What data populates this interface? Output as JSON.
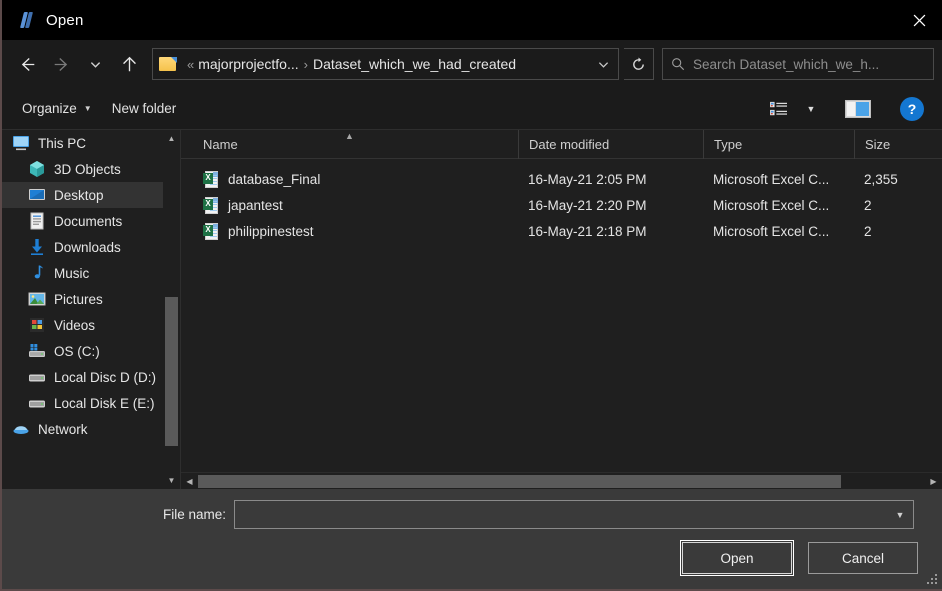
{
  "window": {
    "title": "Open",
    "icon": "python-file-icon",
    "close_label": "Close"
  },
  "nav": {
    "back": "Back",
    "forward": "Forward",
    "recent": "Recent locations",
    "up": "Up one level",
    "refresh": "Refresh",
    "breadcrumb": {
      "overflow": "«",
      "separator": "›",
      "parent": "majorprojectfo...",
      "current": "Dataset_which_we_had_created"
    },
    "search": {
      "placeholder": "Search Dataset_which_we_h...",
      "value": ""
    }
  },
  "commandbar": {
    "organize": "Organize",
    "new_folder": "New folder",
    "change_view": "Change your view",
    "preview_pane": "Show the preview pane",
    "help": "?"
  },
  "sidebar": {
    "items": [
      {
        "label": "This PC",
        "icon": "monitor-icon",
        "root": true,
        "selected": false
      },
      {
        "label": "3D Objects",
        "icon": "cube-icon",
        "root": false,
        "selected": false
      },
      {
        "label": "Desktop",
        "icon": "desktop-icon",
        "root": false,
        "selected": true
      },
      {
        "label": "Documents",
        "icon": "document-icon",
        "root": false,
        "selected": false
      },
      {
        "label": "Downloads",
        "icon": "download-icon",
        "root": false,
        "selected": false
      },
      {
        "label": "Music",
        "icon": "music-icon",
        "root": false,
        "selected": false
      },
      {
        "label": "Pictures",
        "icon": "pictures-icon",
        "root": false,
        "selected": false
      },
      {
        "label": "Videos",
        "icon": "videos-icon",
        "root": false,
        "selected": false
      },
      {
        "label": "OS (C:)",
        "icon": "os-drive-icon",
        "root": false,
        "selected": false
      },
      {
        "label": "Local Disc D (D:)",
        "icon": "drive-icon",
        "root": false,
        "selected": false
      },
      {
        "label": "Local Disk E (E:)",
        "icon": "drive-icon",
        "root": false,
        "selected": false
      },
      {
        "label": "Network",
        "icon": "network-icon",
        "root": true,
        "selected": false
      }
    ]
  },
  "filelist": {
    "columns": [
      "Name",
      "Date modified",
      "Type",
      "Size"
    ],
    "sorted_by": "Name",
    "sort_direction": "ascending",
    "rows": [
      {
        "name": "database_Final",
        "date": "16-May-21 2:05 PM",
        "type": "Microsoft Excel C...",
        "size": "2,355",
        "icon": "excel-csv-icon"
      },
      {
        "name": "japantest",
        "date": "16-May-21 2:20 PM",
        "type": "Microsoft Excel C...",
        "size": "2",
        "icon": "excel-csv-icon"
      },
      {
        "name": "philippinestest",
        "date": "16-May-21 2:18 PM",
        "type": "Microsoft Excel C...",
        "size": "2",
        "icon": "excel-csv-icon"
      }
    ]
  },
  "footer": {
    "filename_label": "File name:",
    "filename_value": "",
    "open_button": "Open",
    "cancel_button": "Cancel"
  },
  "colors": {
    "accent": "#1477d1",
    "window_bg": "#1f1f1f",
    "footer_bg": "#3a3a3a",
    "titlebar_bg": "#000000",
    "selection": "#333333",
    "excel_green": "#1e7145",
    "folder_yellow": "#f5c24b"
  }
}
